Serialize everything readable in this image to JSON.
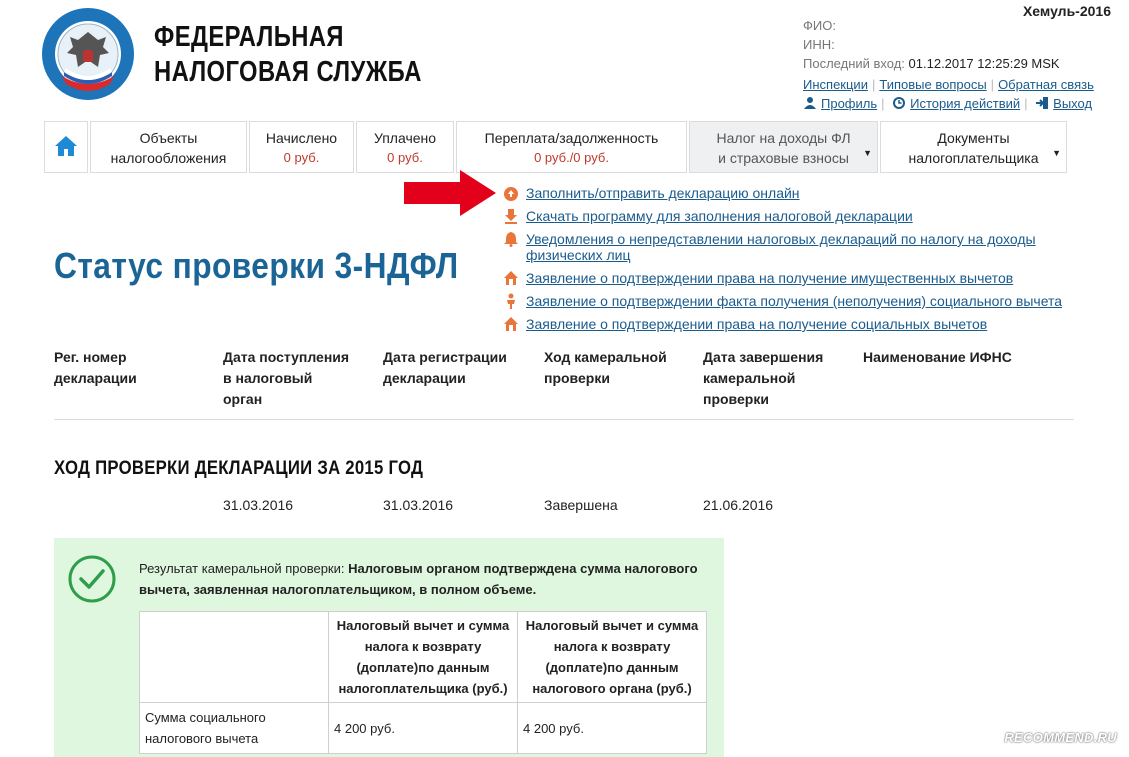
{
  "watermark": "Хемуль-2016",
  "brand": {
    "line1": "ФЕДЕРАЛЬНАЯ",
    "line2": "НАЛОГОВАЯ СЛУЖБА",
    "seal_text": "ФЕДЕРАЛЬНАЯ НАЛОГОВАЯ СЛУЖБА"
  },
  "user": {
    "fio_label": "ФИО:",
    "inn_label": "ИНН:",
    "last_login_label": "Последний вход:",
    "last_login_value": "01.12.2017 12:25:29 MSK",
    "links": [
      "Инспекции",
      "Типовые вопросы",
      "Обратная связь"
    ],
    "profile": "Профиль",
    "history": "История действий",
    "logout": "Выход"
  },
  "nav": {
    "home_icon": "house-icon",
    "tabs": [
      {
        "line1": "Объекты",
        "line2": "налогообложения"
      },
      {
        "line1": "Начислено",
        "line2": "0 руб."
      },
      {
        "line1": "Уплачено",
        "line2": "0 руб."
      },
      {
        "line1": "Переплата/задолженность",
        "line2": "0 руб./0 руб."
      },
      {
        "line1": "Налог на доходы ФЛ",
        "line2": "и страховые взносы"
      },
      {
        "line1": "Документы",
        "line2": "налогоплательщика"
      }
    ]
  },
  "menu": [
    "Заполнить/отправить декларацию онлайн",
    "Скачать программу для заполнения налоговой декларации",
    "Уведомления о непредставлении налоговых деклараций по налогу на доходы",
    "физических лиц",
    "Заявление о подтверждении права на получение имущественных вычетов",
    "Заявление о подтверждении факта получения (неполучения) социального вычета",
    "Заявление о подтверждении права на получение социальных вычетов"
  ],
  "page_title": "Статус проверки 3-НДФЛ",
  "table_headers": [
    [
      "Рег. номер",
      "декларации"
    ],
    [
      "Дата поступления",
      "в налоговый",
      "орган"
    ],
    [
      "Дата регистрации",
      "декларации"
    ],
    [
      "Ход камеральной",
      "проверки"
    ],
    [
      "Дата завершения",
      "камеральной",
      "проверки"
    ],
    [
      "Наименование ИФНС"
    ]
  ],
  "section_title": "ХОД ПРОВЕРКИ ДЕКЛАРАЦИИ ЗА 2015 ГОД",
  "row": {
    "received": "31.03.2016",
    "registered": "31.03.2016",
    "status": "Завершена",
    "completed": "21.06.2016"
  },
  "result": {
    "label": "Результат камеральной проверки:",
    "text": "Налоговым органом подтверждена сумма налогового вычета, заявленная налогоплательщиком, в полном объеме."
  },
  "inner_table": {
    "col1": [
      "Налоговый вычет и сумма",
      "налога к возврату",
      "(доплате)по данным",
      "налогоплательщика (руб.)"
    ],
    "col2": [
      "Налоговый вычет и сумма",
      "налога к возврату",
      "(доплате)по данным",
      "налогового органа (руб.)"
    ],
    "row_label": [
      "Сумма социального",
      "налогового вычета"
    ],
    "v1": "4 200 руб.",
    "v2": "4 200 руб."
  },
  "badge": "RECOMMEND.RU",
  "colors": {
    "accent": "#1a6496",
    "link": "#1a5b8d",
    "amount": "#c0392b",
    "success_bg": "#dff7df",
    "success": "#2e9e4a",
    "arrow": "#e3001b"
  }
}
